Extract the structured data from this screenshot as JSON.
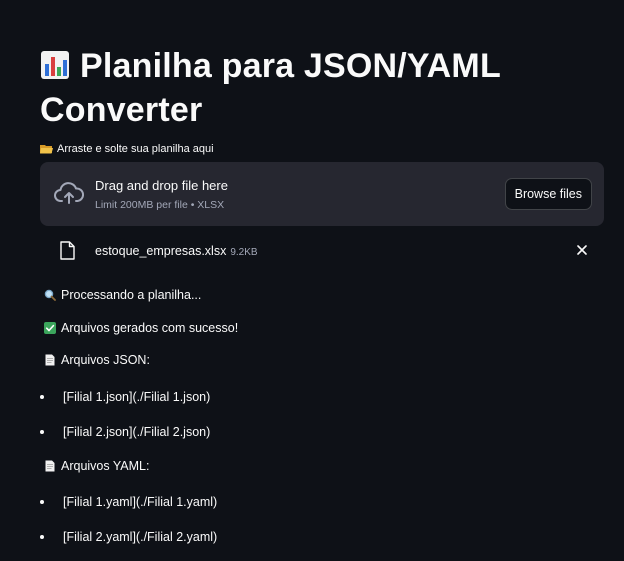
{
  "title": {
    "emoji_icon": "bar-chart-icon",
    "text": "Planilha para JSON/YAML Converter"
  },
  "uploader": {
    "label_icon": "open-folder-icon",
    "label": "Arraste e solte sua planilha aqui",
    "dropzone_icon": "cloud-upload-icon",
    "main_text": "Drag and drop file here",
    "sub_text": "Limit 200MB per file • XLSX",
    "browse_label": "Browse files"
  },
  "uploaded_file": {
    "icon": "file-icon",
    "name": "estoque_empresas.xlsx",
    "size": "9.2KB",
    "remove_icon": "close-icon"
  },
  "messages": {
    "processing": {
      "icon": "magnifier-icon",
      "text": "Processando a planilha..."
    },
    "success": {
      "icon": "check-mark-icon",
      "text": "Arquivos gerados com sucesso!"
    }
  },
  "json_section": {
    "icon": "document-icon",
    "heading": "Arquivos JSON:",
    "items": [
      "[Filial 1.json](./Filial 1.json)",
      "[Filial 2.json](./Filial 2.json)"
    ]
  },
  "yaml_section": {
    "icon": "document-icon",
    "heading": "Arquivos YAML:",
    "items": [
      "[Filial 1.yaml](./Filial 1.yaml)",
      "[Filial 2.yaml](./Filial 2.yaml)"
    ]
  },
  "colors": {
    "background": "#0e1117",
    "dropzone": "#262730",
    "text": "#fafafa",
    "muted_text": "#a3a8b8",
    "success_green": "#3ba55c"
  }
}
